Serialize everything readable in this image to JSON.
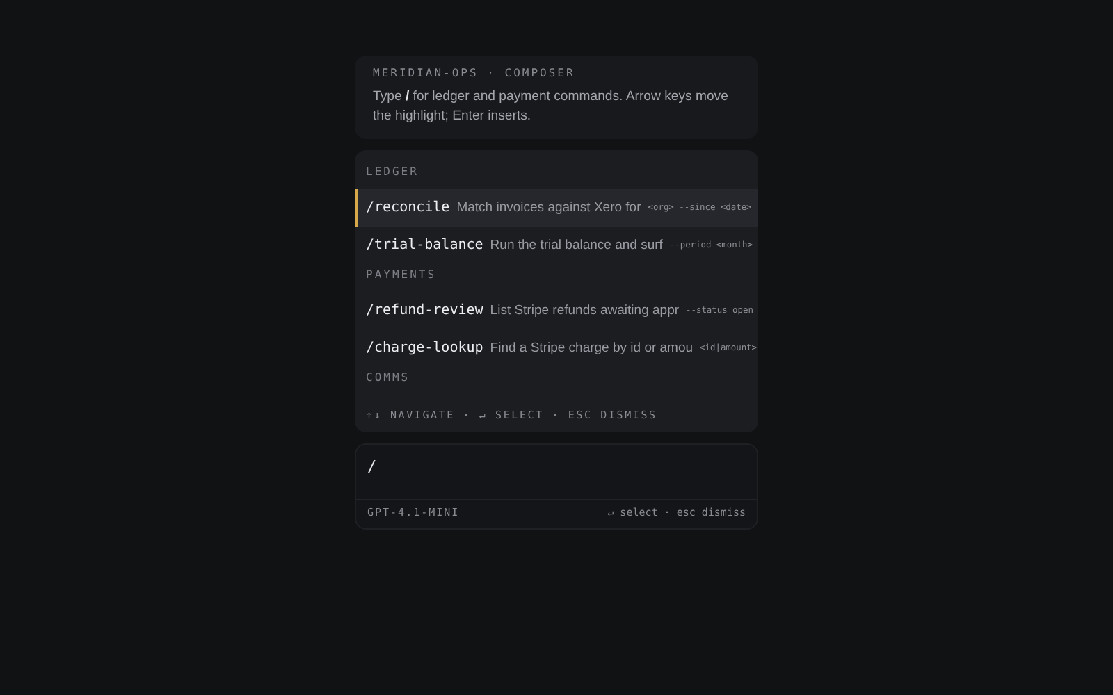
{
  "header": {
    "eyebrow": "MERIDIAN-OPS · COMPOSER",
    "hint": "Type **/** for ledger and payment commands. Arrow keys move the highlight; Enter inserts."
  },
  "menu": {
    "groups": [
      {
        "label": "LEDGER",
        "items": [
          {
            "command": "/reconcile",
            "description": "Match invoices against Xero for",
            "args": "<org> --since <date>",
            "selected": true
          },
          {
            "command": "/trial-balance",
            "description": "Run the trial balance and surf",
            "args": "--period <month>",
            "selected": false
          }
        ]
      },
      {
        "label": "PAYMENTS",
        "items": [
          {
            "command": "/refund-review",
            "description": "List Stripe refunds awaiting appr",
            "args": "--status open",
            "selected": false
          },
          {
            "command": "/charge-lookup",
            "description": "Find a Stripe charge by id or amou",
            "args": "<id|amount>",
            "selected": false
          }
        ]
      },
      {
        "label": "COMMS"
      }
    ],
    "footer": "↑↓ NAVIGATE · ↵ SELECT · ESC DISMISS"
  },
  "composer": {
    "value": "/",
    "model": "GPT-4.1-MINI",
    "shortcuts": "↵ select · esc dismiss"
  }
}
